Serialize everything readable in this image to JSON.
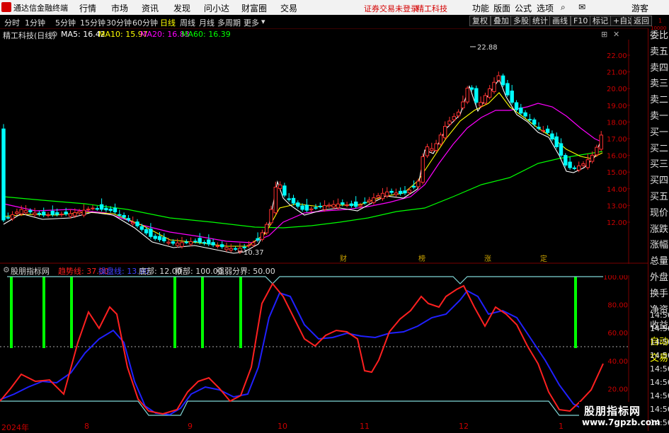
{
  "app": {
    "name": "通达信金融终端",
    "menu": [
      "行情",
      "市场",
      "资讯",
      "发现",
      "问小达",
      "财富圈",
      "交易"
    ],
    "notice": "证券交易未登录",
    "notice_stock": "精工科技",
    "right_menu": [
      "功能",
      "版面",
      "公式",
      "选项"
    ],
    "guest": "游客"
  },
  "toolbar": {
    "timeframes": [
      "分时",
      "1分钟",
      "5分钟",
      "15分钟",
      "30分钟",
      "60分钟",
      "日线",
      "周线",
      "月线",
      "多周期",
      "更多"
    ],
    "active_timeframe": "日线",
    "right_buttons": [
      "复权",
      "叠加",
      "多股",
      "统计",
      "画线",
      "F10",
      "标记",
      "+自选",
      "返回"
    ]
  },
  "stock": {
    "title": "精工科技(日线)",
    "ma5": "MA5: 16.42",
    "ma10": "MA10: 15.97",
    "ma20": "MA20: 16.83",
    "ma60": "MA60: 16.39",
    "high_label": "22.88",
    "low_label": "10.37"
  },
  "price_axis": [
    "22.00",
    "21.00",
    "20.00",
    "19.00",
    "18.00",
    "17.00",
    "16.00",
    "15.00",
    "14.00",
    "13.00",
    "12.00"
  ],
  "event_markers": [
    "财",
    "榜",
    "涨",
    "定"
  ],
  "indicator": {
    "name": "股朋指标网",
    "fields": [
      {
        "label": "趋势线: 37.00",
        "color": "#ff2020"
      },
      {
        "label": "操盘线: 13.90",
        "color": "#2020ff"
      },
      {
        "label": "底部: 12.00",
        "color": "#cccccc"
      },
      {
        "label": "顶部: 100.00",
        "color": "#cccccc"
      },
      {
        "label": "强弱分界: 50.00",
        "color": "#cccccc"
      }
    ],
    "axis": [
      "100.00",
      "80.00",
      "60.00",
      "40.00",
      "20.00"
    ]
  },
  "x_axis": [
    "2024年",
    "8",
    "9",
    "10",
    "11",
    "12",
    "1"
  ],
  "right_panel": {
    "top_small": [
      "1",
      "10000"
    ],
    "items": [
      "委比",
      "卖五",
      "卖四",
      "卖三",
      "卖二",
      "卖一",
      "买一",
      "买二",
      "买三",
      "买四",
      "买五",
      "现价",
      "涨跌",
      "涨幅",
      "总量",
      "外盘",
      "换手",
      "净资",
      "收益",
      "自动",
      "交易"
    ],
    "times": [
      "14:56",
      "14:56",
      "14:56",
      "14:56",
      "14:56",
      "14:56",
      "14:56",
      "14:56",
      "14:56"
    ]
  },
  "watermark": {
    "title": "股朋指标网",
    "url": "www.7gpzb.com"
  },
  "colors": {
    "ma5": "#ffffff",
    "ma10": "#ffff00",
    "ma20": "#ff00ff",
    "ma60": "#00ff00",
    "up": "#ff3030",
    "down": "#00ffff",
    "trend": "#ff2020",
    "operate": "#2020ff",
    "signal": "#00ff00"
  }
}
